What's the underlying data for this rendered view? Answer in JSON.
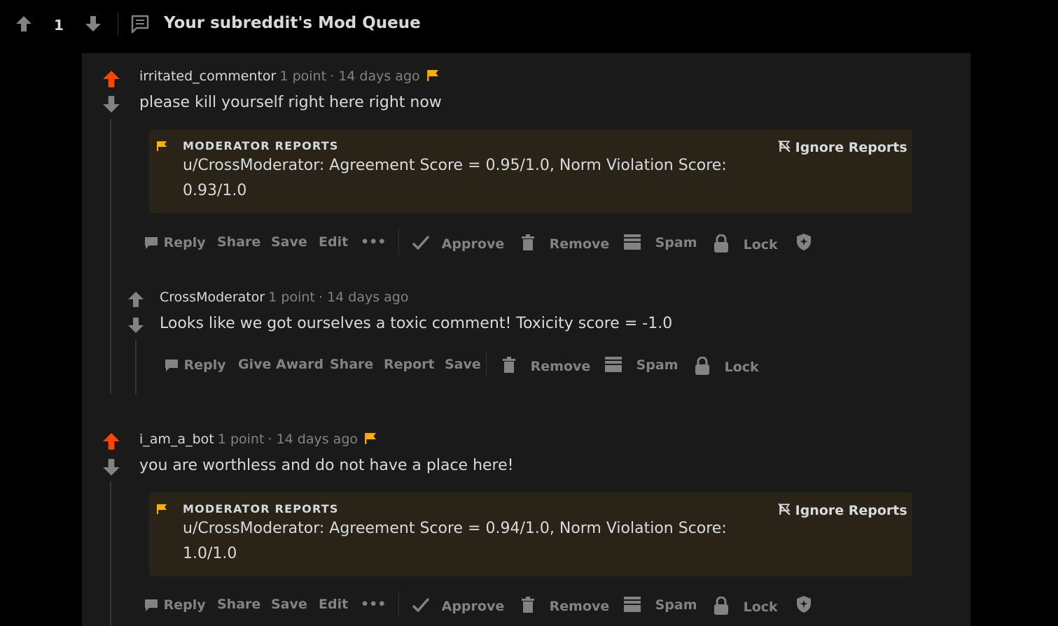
{
  "post": {
    "score": "1",
    "title": "Your subreddit's Mod Queue"
  },
  "colors": {
    "upvote": "#ff4500",
    "flag": "#ffb000",
    "bg": "#1a1a1b",
    "report_bg": "#2a2418"
  },
  "comments": [
    {
      "author": "irritated_commentor",
      "points": "1 point",
      "age": "· 14 days ago",
      "body": "please kill yourself right here right now",
      "report_title": "MODERATOR REPORTS",
      "report_line1": "u/CrossModerator: Agreement Score = 0.95/1.0, Norm Violation Score:",
      "report_line2": "0.93/1.0",
      "ignore": "Ignore Reports",
      "actions": {
        "reply": "Reply",
        "share": "Share",
        "save": "Save",
        "edit": "Edit",
        "more": "•••",
        "approve": "Approve",
        "remove": "Remove",
        "spam": "Spam",
        "lock": "Lock"
      }
    },
    {
      "author": "i_am_a_bot",
      "points": "1 point",
      "age": "· 14 days ago",
      "body": "you are worthless and do not have a place here!",
      "report_title": "MODERATOR REPORTS",
      "report_line1": "u/CrossModerator: Agreement Score = 0.94/1.0, Norm Violation Score:",
      "report_line2": "1.0/1.0",
      "ignore": "Ignore Reports",
      "actions": {
        "reply": "Reply",
        "share": "Share",
        "save": "Save",
        "edit": "Edit",
        "more": "•••",
        "approve": "Approve",
        "remove": "Remove",
        "spam": "Spam",
        "lock": "Lock"
      }
    }
  ],
  "reply": {
    "author": "CrossModerator",
    "points": "1 point",
    "age": "· 14 days ago",
    "body": "Looks like we got ourselves a toxic comment! Toxicity score = -1.0",
    "actions": {
      "reply": "Reply",
      "award": "Give Award",
      "share": "Share",
      "report": "Report",
      "save": "Save",
      "remove": "Remove",
      "spam": "Spam",
      "lock": "Lock"
    }
  }
}
